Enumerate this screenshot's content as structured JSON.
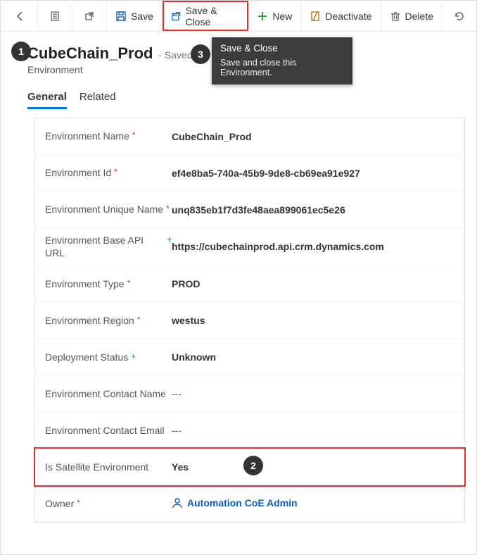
{
  "toolbar": {
    "save_label": "Save",
    "save_close_label": "Save & Close",
    "new_label": "New",
    "deactivate_label": "Deactivate",
    "delete_label": "Delete"
  },
  "tooltip": {
    "title": "Save & Close",
    "body": "Save and close this Environment."
  },
  "header": {
    "title": "CubeChain_Prod",
    "status": "- Saved",
    "entity": "Environment"
  },
  "tabs": {
    "general": "General",
    "related": "Related"
  },
  "callouts": {
    "one": "1",
    "two": "2",
    "three": "3"
  },
  "fields": {
    "env_name": {
      "label": "Environment Name",
      "mark": "*",
      "value": "CubeChain_Prod"
    },
    "env_id": {
      "label": "Environment Id",
      "mark": "*",
      "value": "ef4e8ba5-740a-45b9-9de8-cb69ea91e927"
    },
    "env_unique": {
      "label": "Environment Unique Name",
      "mark": "*",
      "value": "unq835eb1f7d3fe48aea899061ec5e26"
    },
    "env_url": {
      "label": "Environment Base API URL",
      "mark": "+",
      "value": "https://cubechainprod.api.crm.dynamics.com"
    },
    "env_type": {
      "label": "Environment Type",
      "mark": "*",
      "value": "PROD"
    },
    "env_region": {
      "label": "Environment Region",
      "mark": "*",
      "value": "westus"
    },
    "deploy_status": {
      "label": "Deployment Status",
      "mark": "+",
      "value": "Unknown"
    },
    "contact_name": {
      "label": "Environment Contact Name",
      "mark": "",
      "value": "---"
    },
    "contact_email": {
      "label": "Environment Contact Email",
      "mark": "",
      "value": "---"
    },
    "is_satellite": {
      "label": "Is Satellite Environment",
      "mark": "",
      "value": "Yes"
    },
    "owner": {
      "label": "Owner",
      "mark": "*",
      "value": "Automation CoE Admin"
    }
  }
}
